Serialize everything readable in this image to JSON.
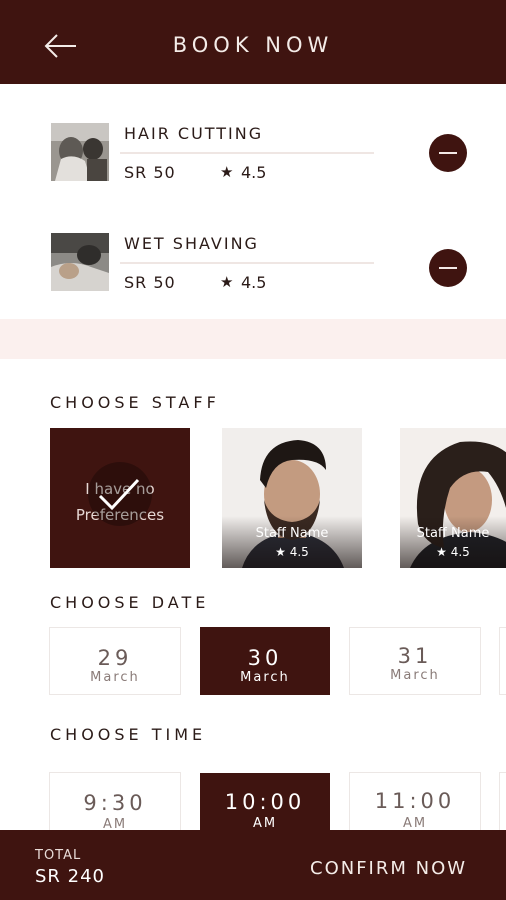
{
  "header": {
    "title": "BOOK NOW",
    "back_icon": "arrow-left-icon"
  },
  "services": [
    {
      "name": "HAIR CUTTING",
      "price": "SR 50",
      "rating": "4.5",
      "remove_icon": "minus-circle-icon"
    },
    {
      "name": "WET SHAVING",
      "price": "SR 50",
      "rating": "4.5",
      "remove_icon": "minus-circle-icon"
    }
  ],
  "staff": {
    "label": "CHOOSE STAFF",
    "no_preference": {
      "line1": "I have no",
      "line2": "Preferences",
      "selected": true
    },
    "members": [
      {
        "name": "Staff Name",
        "rating": "4.5"
      },
      {
        "name": "Staff Name",
        "rating": "4.5"
      }
    ]
  },
  "dates": {
    "label": "CHOOSE DATE",
    "items": [
      {
        "day": "29",
        "month": "March",
        "selected": false
      },
      {
        "day": "30",
        "month": "March",
        "selected": true
      },
      {
        "day": "31",
        "month": "March",
        "selected": false
      }
    ]
  },
  "times": {
    "label": "CHOOSE TIME",
    "items": [
      {
        "time": "9:30",
        "period": "AM",
        "selected": false
      },
      {
        "time": "10:00",
        "period": "AM",
        "selected": true
      },
      {
        "time": "11:00",
        "period": "AM",
        "selected": false
      }
    ]
  },
  "footer": {
    "total_label": "TOTAL",
    "total_value": "SR 240",
    "confirm_label": "CONFIRM NOW"
  },
  "colors": {
    "primary": "#3f1410",
    "band": "#fbf0ee",
    "chip_border": "#ece7e5"
  }
}
